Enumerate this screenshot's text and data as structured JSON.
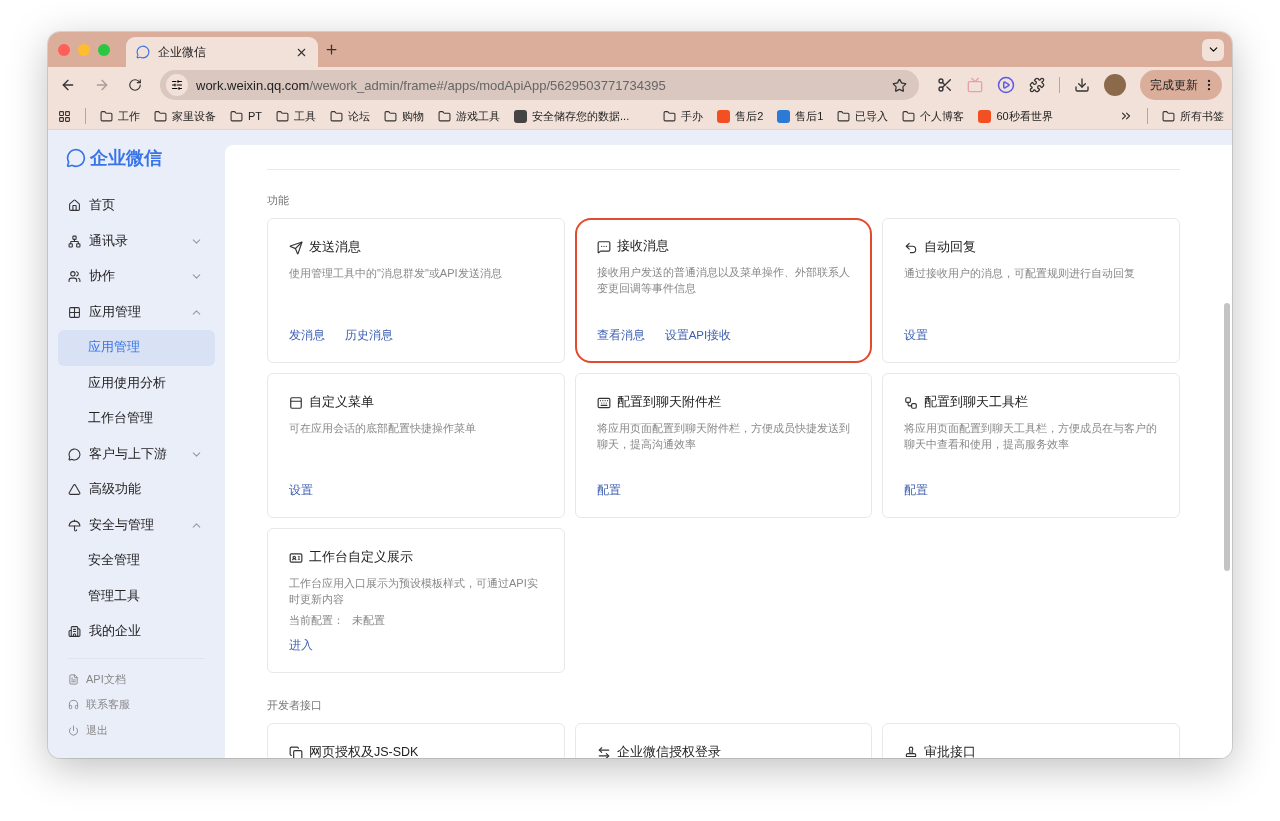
{
  "browser": {
    "tab": {
      "title": "企业微信",
      "selected": true
    },
    "address": {
      "host": "work.weixin.qq.com",
      "path": "/wework_admin/frame#/apps/modApiApp/5629503771734395"
    },
    "update_button": "完成更新",
    "bookmarks": [
      {
        "kind": "folder",
        "label": "工作"
      },
      {
        "kind": "folder",
        "label": "家里设备"
      },
      {
        "kind": "folder",
        "label": "PT"
      },
      {
        "kind": "folder",
        "label": "工具"
      },
      {
        "kind": "folder",
        "label": "论坛"
      },
      {
        "kind": "folder",
        "label": "购物"
      },
      {
        "kind": "folder",
        "label": "游戏工具"
      },
      {
        "kind": "site",
        "label": "安全储存您的数据..."
      },
      {
        "kind": "folder",
        "label": "手办"
      },
      {
        "kind": "site",
        "label": "售后2"
      },
      {
        "kind": "site",
        "label": "售后1"
      },
      {
        "kind": "folder",
        "label": "已导入"
      },
      {
        "kind": "folder",
        "label": "个人博客"
      },
      {
        "kind": "site",
        "label": "60秒看世界"
      }
    ],
    "all_bookmarks": "所有书签"
  },
  "sidebar": {
    "logo": "企业微信",
    "items": [
      {
        "label": "首页"
      },
      {
        "label": "通讯录",
        "expanded": false
      },
      {
        "label": "协作",
        "expanded": false
      },
      {
        "label": "应用管理",
        "expanded": true,
        "children": [
          {
            "label": "应用管理",
            "selected": true
          },
          {
            "label": "应用使用分析",
            "selected": false
          },
          {
            "label": "工作台管理",
            "selected": false
          }
        ]
      },
      {
        "label": "客户与上下游",
        "expanded": false
      },
      {
        "label": "高级功能"
      },
      {
        "label": "安全与管理",
        "expanded": true,
        "children": [
          {
            "label": "安全管理",
            "selected": false
          },
          {
            "label": "管理工具",
            "selected": false
          }
        ]
      },
      {
        "label": "我的企业"
      }
    ],
    "footer": [
      "API文档",
      "联系客服",
      "退出"
    ]
  },
  "sections": [
    {
      "title": "功能",
      "cards": [
        {
          "title": "发送消息",
          "description": "使用管理工具中的\"消息群发\"或API发送消息",
          "links": [
            "发消息",
            "历史消息"
          ],
          "highlighted": false
        },
        {
          "title": "接收消息",
          "description": "接收用户发送的普通消息以及菜单操作、外部联系人变更回调等事件信息",
          "links": [
            "查看消息",
            "设置API接收"
          ],
          "highlighted": true
        },
        {
          "title": "自动回复",
          "description": "通过接收用户的消息，可配置规则进行自动回复",
          "links": [
            "设置"
          ],
          "highlighted": false
        },
        {
          "title": "自定义菜单",
          "description": "可在应用会话的底部配置快捷操作菜单",
          "links": [
            "设置"
          ],
          "highlighted": false
        },
        {
          "title": "配置到聊天附件栏",
          "description": "将应用页面配置到聊天附件栏，方便成员快捷发送到聊天，提高沟通效率",
          "links": [
            "配置"
          ],
          "highlighted": false
        },
        {
          "title": "配置到聊天工具栏",
          "description": "将应用页面配置到聊天工具栏，方便成员在与客户的聊天中查看和使用，提高服务效率",
          "links": [
            "配置"
          ],
          "highlighted": false
        },
        {
          "title": "工作台自定义展示",
          "description": "工作台应用入口展示为预设模板样式，可通过API实时更新内容",
          "meta_label": "当前配置：",
          "meta_value": "未配置",
          "links": [
            "进入"
          ],
          "highlighted": false
        }
      ]
    },
    {
      "title": "开发者接口",
      "cards": [
        {
          "title": "网页授权及JS-SDK",
          "highlighted": false
        },
        {
          "title": "企业微信授权登录",
          "highlighted": false
        },
        {
          "title": "审批接口",
          "highlighted": false
        }
      ]
    }
  ]
}
